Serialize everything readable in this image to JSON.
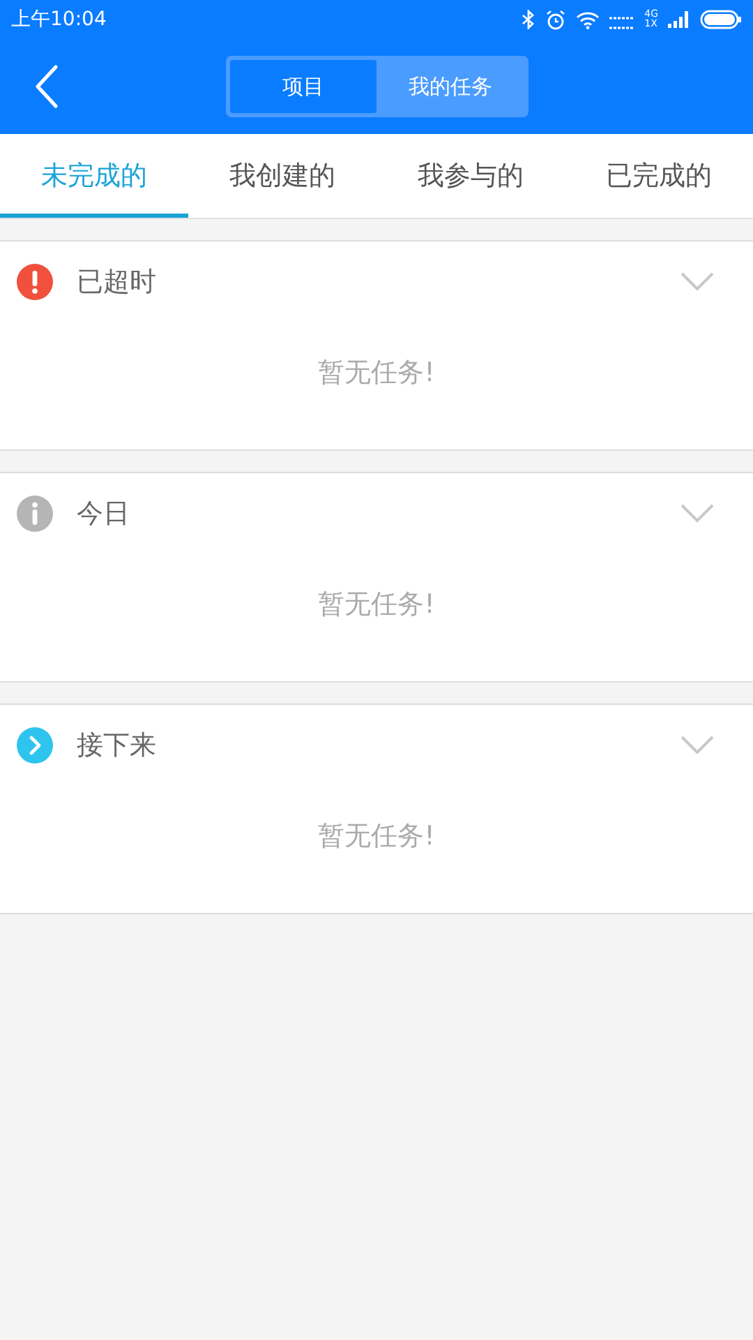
{
  "status_bar": {
    "time": "上午10:04",
    "network_top": "4G",
    "network_bottom": "1X"
  },
  "header": {
    "segments": [
      {
        "label": "项目",
        "selected": true
      },
      {
        "label": "我的任务",
        "selected": false
      }
    ]
  },
  "tabs": [
    {
      "label": "未完成的",
      "selected": true
    },
    {
      "label": "我创建的",
      "selected": false
    },
    {
      "label": "我参与的",
      "selected": false
    },
    {
      "label": "已完成的",
      "selected": false
    }
  ],
  "sections": [
    {
      "kind": "overdue",
      "title": "已超时",
      "empty_text": "暂无任务!"
    },
    {
      "kind": "today",
      "title": "今日",
      "empty_text": "暂无任务!"
    },
    {
      "kind": "upcoming",
      "title": "接下来",
      "empty_text": "暂无任务!"
    }
  ]
}
